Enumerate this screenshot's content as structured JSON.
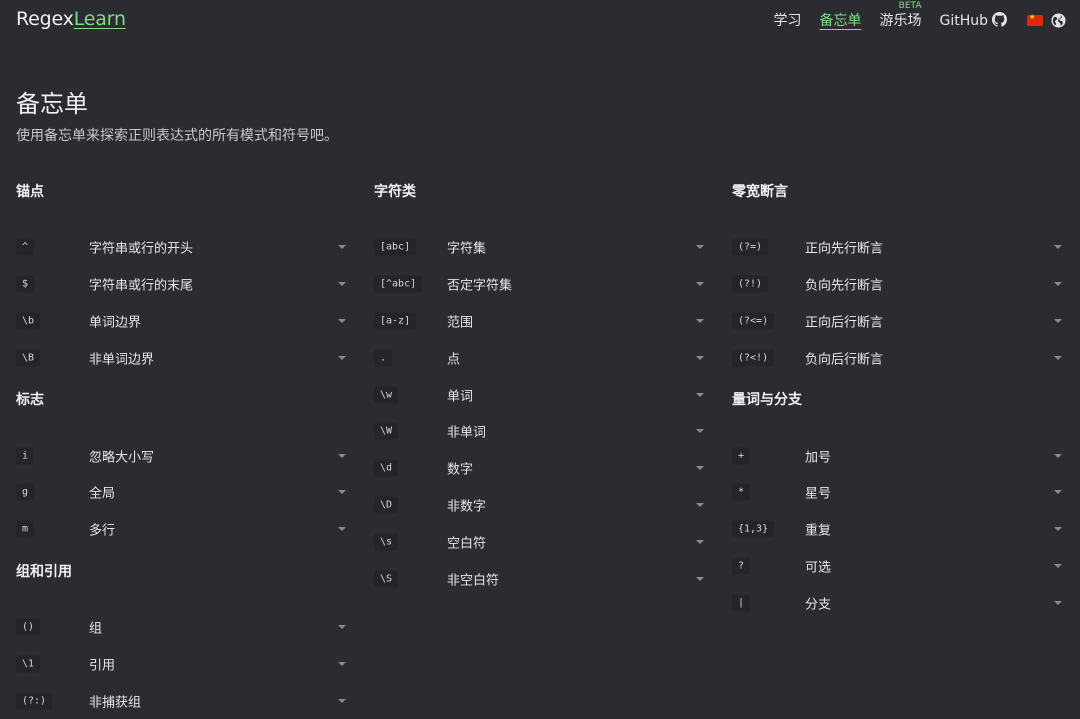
{
  "app": {
    "logo_main": "Regex",
    "logo_accent": "Learn"
  },
  "nav": {
    "learn": "学习",
    "cheatsheet": "备忘单",
    "playground": "游乐场",
    "beta": "BETA",
    "github": "GitHub"
  },
  "header": {
    "title": "备忘单",
    "subtitle": "使用备忘单来探索正则表达式的所有模式和符号吧。"
  },
  "columns": [
    {
      "sections": [
        {
          "title": "锚点",
          "items": [
            {
              "code": "^",
              "label": "字符串或行的开头"
            },
            {
              "code": "$",
              "label": "字符串或行的末尾"
            },
            {
              "code": "\\b",
              "label": "单词边界"
            },
            {
              "code": "\\B",
              "label": "非单词边界"
            }
          ]
        },
        {
          "title": "标志",
          "items": [
            {
              "code": "i",
              "label": "忽略大小写"
            },
            {
              "code": "g",
              "label": "全局"
            },
            {
              "code": "m",
              "label": "多行"
            }
          ]
        },
        {
          "title": "组和引用",
          "items": [
            {
              "code": "()",
              "label": "组"
            },
            {
              "code": "\\1",
              "label": "引用"
            },
            {
              "code": "(?:)",
              "label": "非捕获组"
            }
          ]
        }
      ]
    },
    {
      "sections": [
        {
          "title": "字符类",
          "items": [
            {
              "code": "[abc]",
              "label": "字符集"
            },
            {
              "code": "[^abc]",
              "label": "否定字符集"
            },
            {
              "code": "[a-z]",
              "label": "范围"
            },
            {
              "code": ".",
              "label": "点"
            },
            {
              "code": "\\w",
              "label": "单词"
            },
            {
              "code": "\\W",
              "label": "非单词"
            },
            {
              "code": "\\d",
              "label": "数字"
            },
            {
              "code": "\\D",
              "label": "非数字"
            },
            {
              "code": "\\s",
              "label": "空白符"
            },
            {
              "code": "\\S",
              "label": "非空白符"
            }
          ]
        }
      ]
    },
    {
      "sections": [
        {
          "title": "零宽断言",
          "items": [
            {
              "code": "(?=)",
              "label": "正向先行断言"
            },
            {
              "code": "(?!)",
              "label": "负向先行断言"
            },
            {
              "code": "(?<=)",
              "label": "正向后行断言"
            },
            {
              "code": "(?<!)",
              "label": "负向后行断言"
            }
          ]
        },
        {
          "title": "量词与分支",
          "items": [
            {
              "code": "+",
              "label": "加号"
            },
            {
              "code": "*",
              "label": "星号"
            },
            {
              "code": "{1,3}",
              "label": "重复"
            },
            {
              "code": "?",
              "label": "可选"
            },
            {
              "code": "|",
              "label": "分支"
            }
          ]
        }
      ]
    }
  ],
  "icons": {
    "github": "github-icon",
    "flag": "china-flag-icon",
    "globe": "globe-icon",
    "chevron": "chevron-down-icon"
  },
  "colors": {
    "background": "#2a2c31",
    "accent": "#83d98a",
    "text": "#e6e6e6"
  }
}
